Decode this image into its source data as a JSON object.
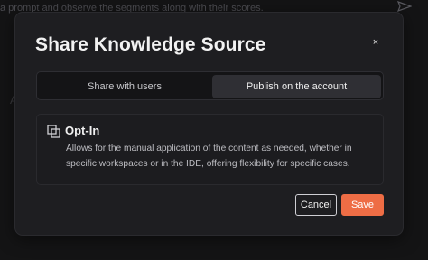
{
  "background": {
    "text": "a prompt and observe the segments along with their scores.",
    "partial_letter": "A",
    "send_icon": "send-icon"
  },
  "modal": {
    "title": "Share Knowledge Source",
    "close_glyph": "×",
    "tabs": [
      {
        "label": "Share with users",
        "selected": false
      },
      {
        "label": "Publish on the account",
        "selected": true
      }
    ],
    "option": {
      "icon": "copy-icon",
      "title": "Opt-In",
      "description": "Allows for the manual application of the content as needed, whether in specific workspaces or in the IDE, offering flexibility for specific cases."
    },
    "buttons": {
      "cancel": "Cancel",
      "save": "Save"
    }
  },
  "colors": {
    "accent": "#ee6d45",
    "modal_bg": "#1e1e21",
    "selected_tab_bg": "#2f2f34"
  }
}
